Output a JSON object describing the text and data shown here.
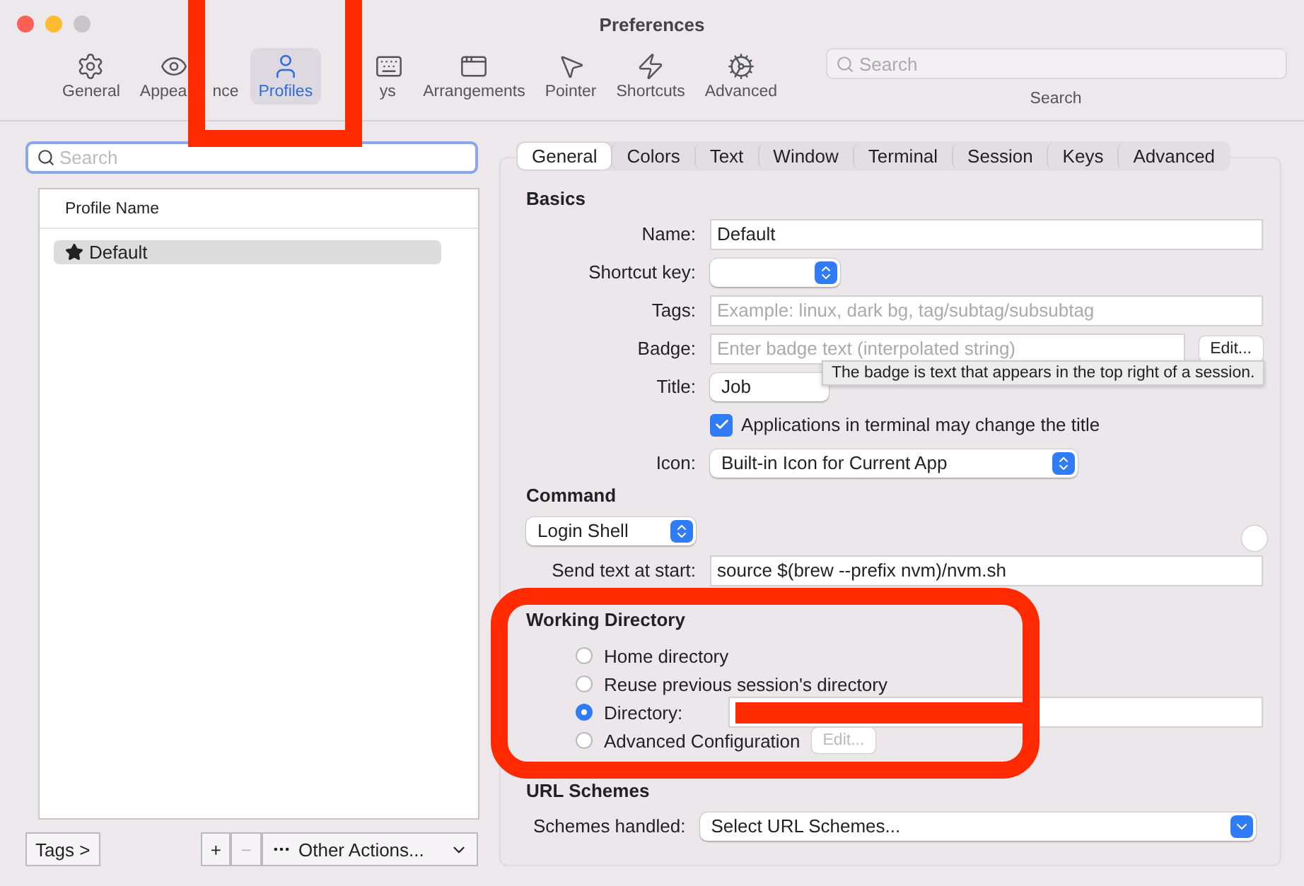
{
  "window": {
    "title": "Preferences"
  },
  "toolbar": {
    "items": [
      {
        "label": "General",
        "selected": false
      },
      {
        "label": "Appea",
        "label_end": "nce",
        "selected": false
      },
      {
        "label": "Profiles",
        "selected": true
      },
      {
        "label": "ys",
        "selected": false
      },
      {
        "label": "Arrangements",
        "selected": false
      },
      {
        "label": "Pointer",
        "selected": false
      },
      {
        "label": "Shortcuts",
        "selected": false
      },
      {
        "label": "Advanced",
        "selected": false
      }
    ],
    "search": {
      "placeholder": "Search",
      "label": "Search"
    }
  },
  "profiles": {
    "search": {
      "placeholder": "Search"
    },
    "column": "Profile Name",
    "rows": [
      {
        "name": "Default",
        "selected": true,
        "default": true
      }
    ],
    "tags_button": "Tags >",
    "add": {
      "label": "+",
      "disabled": false
    },
    "remove": {
      "label": "−",
      "disabled": true
    },
    "actions": "Other Actions..."
  },
  "tabs": [
    {
      "label": "General",
      "selected": true
    },
    {
      "label": "Colors",
      "selected": false
    },
    {
      "label": "Text",
      "selected": false
    },
    {
      "label": "Window",
      "selected": false
    },
    {
      "label": "Terminal",
      "selected": false
    },
    {
      "label": "Session",
      "selected": false
    },
    {
      "label": "Keys",
      "selected": false
    },
    {
      "label": "Advanced",
      "selected": false
    }
  ],
  "basics": {
    "heading": "Basics",
    "name": {
      "label": "Name:",
      "value": "Default"
    },
    "shortcut": {
      "label": "Shortcut key:"
    },
    "tags": {
      "label": "Tags:",
      "placeholder": "Example: linux, dark bg, tag/subtag/subsubtag"
    },
    "badge": {
      "label": "Badge:",
      "placeholder": "Enter badge text (interpolated string)",
      "button": "Edit..."
    },
    "tooltip": "The badge is text that appears in the top right of a session.",
    "title": {
      "label": "Title:",
      "value": "Job"
    },
    "title_checkbox": {
      "label": "Applications in terminal may change the title",
      "checked": true
    },
    "icon": {
      "label": "Icon:",
      "value": "Built-in Icon for Current App"
    }
  },
  "command": {
    "heading": "Command",
    "popup": "Login Shell",
    "send_text": {
      "label": "Send text at start:",
      "value": "source $(brew --prefix nvm)/nvm.sh"
    }
  },
  "working_directory": {
    "heading": "Working Directory",
    "options": [
      {
        "label": "Home directory",
        "selected": false,
        "kind": "plain"
      },
      {
        "label": "Reuse previous session's directory",
        "selected": false,
        "kind": "plain"
      },
      {
        "label": "Directory:",
        "selected": true,
        "kind": "path"
      },
      {
        "label": "Advanced Configuration",
        "selected": false,
        "kind": "edit",
        "button": "Edit...",
        "button_disabled": true
      }
    ]
  },
  "url_schemes": {
    "heading": "URL Schemes",
    "label": "Schemes handled:",
    "value": "Select URL Schemes..."
  }
}
